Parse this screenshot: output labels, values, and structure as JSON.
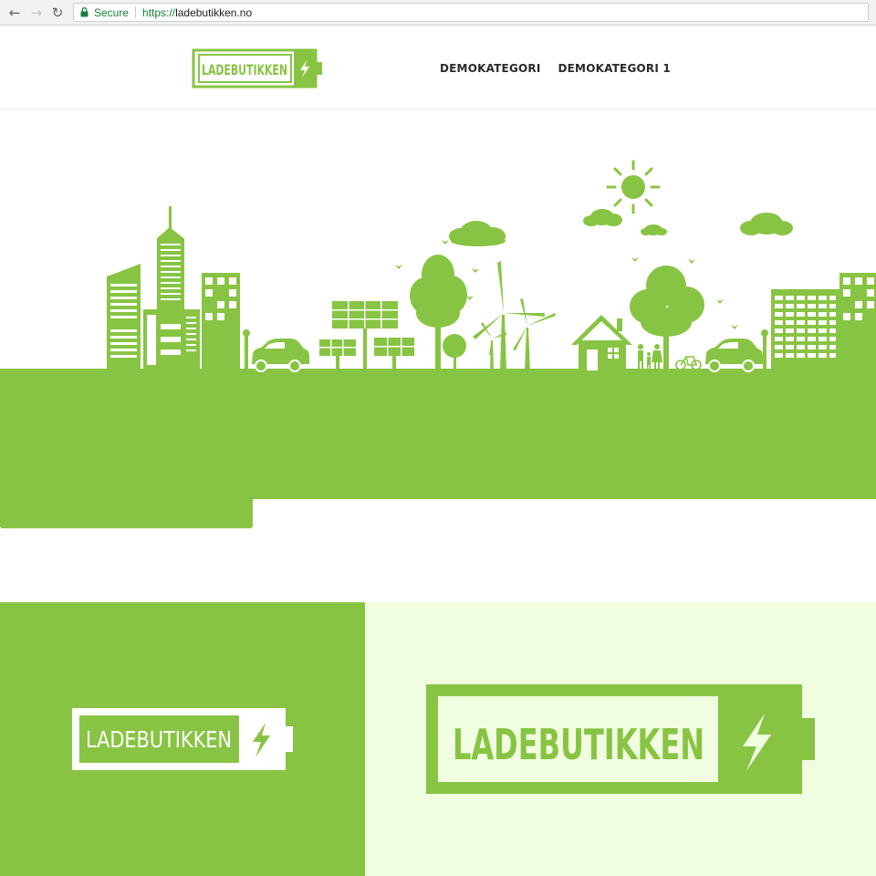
{
  "browser": {
    "back_icon": "arrow-left-icon",
    "forward_icon": "arrow-right-icon",
    "reload_icon": "reload-icon",
    "secure_label": "Secure",
    "url_scheme": "https://",
    "url_host": "ladebutikken.no"
  },
  "brand": {
    "name": "LADEBUTIKKEN",
    "color": "#88c443",
    "logo_icon": "battery-lightning-icon"
  },
  "nav": {
    "items": [
      {
        "label": "DEMOKATEGORI"
      },
      {
        "label": "DEMOKATEGORI 1"
      }
    ]
  },
  "hero": {
    "illustration": "green-city-skyline",
    "ground_color": "#88c443"
  },
  "panels": {
    "left_background": "#88c443",
    "right_background": "#f0fde0"
  }
}
